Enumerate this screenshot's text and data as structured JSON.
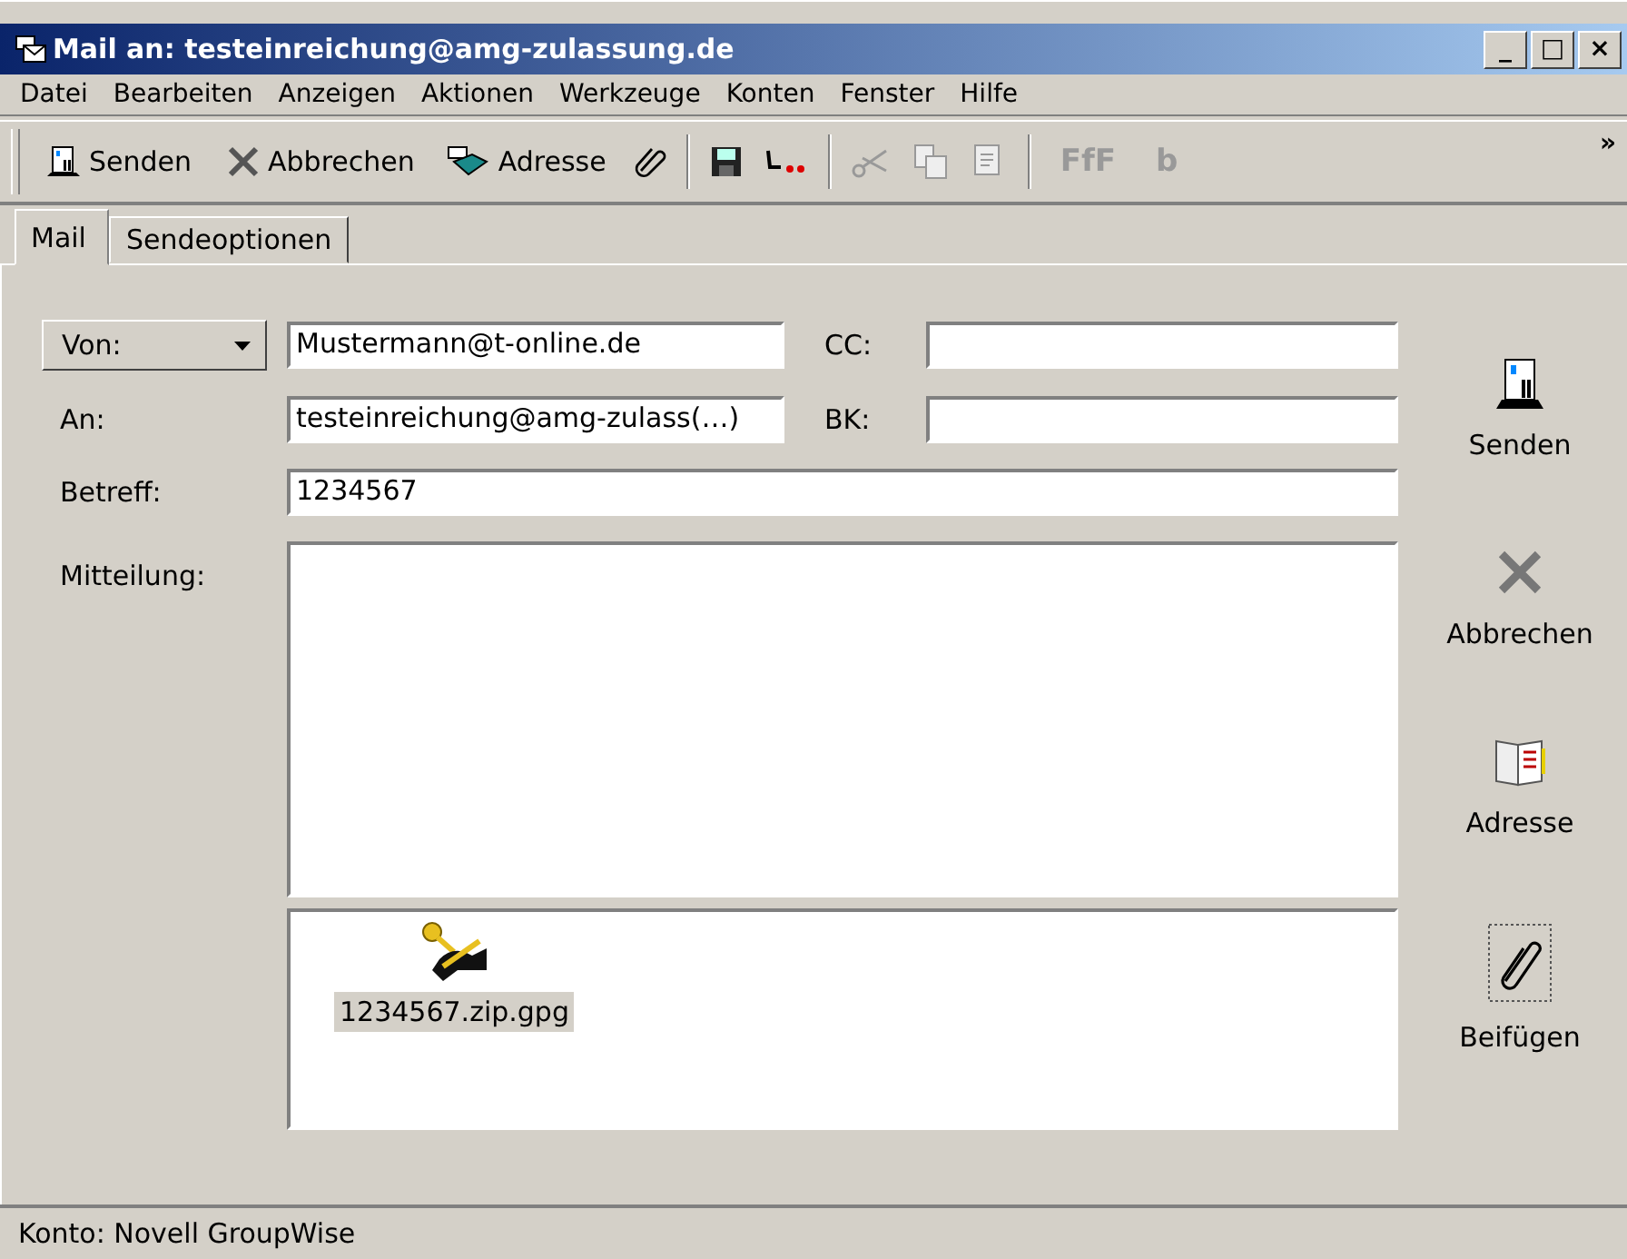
{
  "window": {
    "title": "Mail an: testeinreichung@amg-zulassung.de",
    "controls": [
      "_",
      "□",
      "×"
    ]
  },
  "menu": [
    "Datei",
    "Bearbeiten",
    "Anzeigen",
    "Aktionen",
    "Werkzeuge",
    "Konten",
    "Fenster",
    "Hilfe"
  ],
  "toolbar": {
    "buttons": [
      {
        "label": "Senden"
      },
      {
        "label": "Abbrechen"
      },
      {
        "label": "Adresse"
      }
    ],
    "glyphs": [
      {
        "text": "FfF",
        "disabled": true
      },
      {
        "text": "b",
        "disabled": true
      }
    ],
    "overflow": "»"
  },
  "tabs": [
    {
      "label": "Mail",
      "selected": true
    },
    {
      "label": "Sendeoptionen",
      "selected": false
    }
  ],
  "form": {
    "from_label": "Von:",
    "from": "Mustermann@t-online.de",
    "to_label": "An:",
    "to": "testeinreichung@amg-zulass(…)",
    "cc_label": "CC:",
    "bcc_label": "BK:",
    "subject_label": "Betreff:",
    "subject": "1234567",
    "message_label": "Mitteilung:"
  },
  "attachments": [
    {
      "name": "1234567.zip.gpg",
      "selected": true
    }
  ],
  "side_buttons": [
    {
      "label": "Senden"
    },
    {
      "label": "Abbrechen"
    },
    {
      "label": "Adresse"
    },
    {
      "label": "Beifügen"
    }
  ],
  "status_bar": "Konto: Novell GroupWise"
}
